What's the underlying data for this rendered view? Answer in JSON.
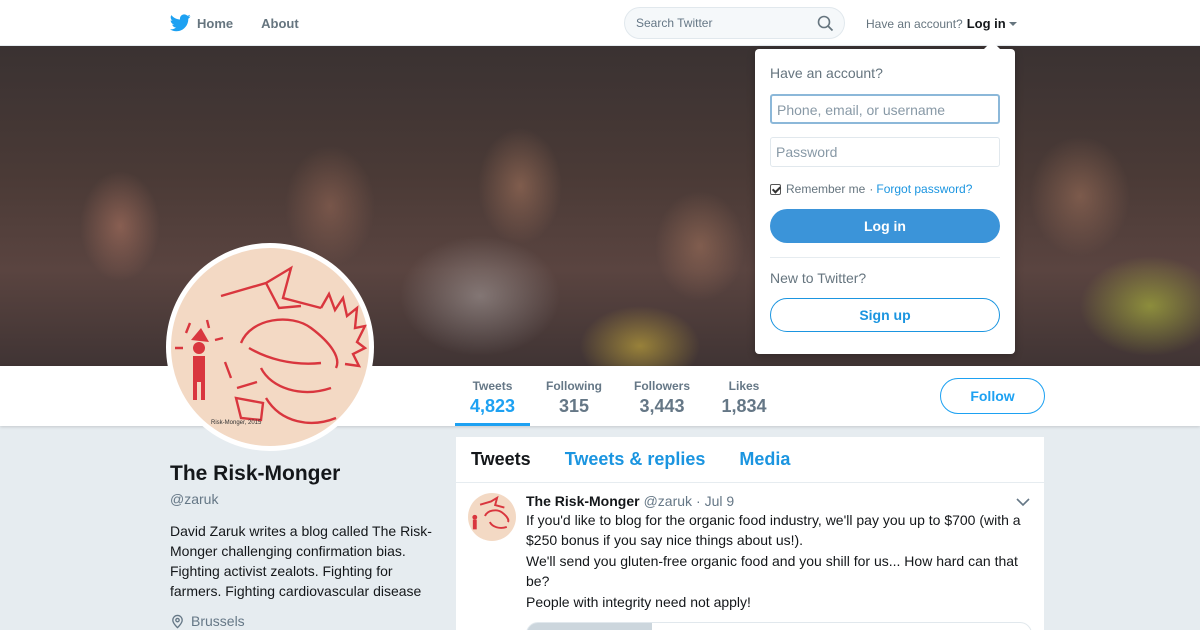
{
  "nav": {
    "home_label": "Home",
    "about_label": "About",
    "search_placeholder": "Search Twitter",
    "have_account_text": "Have an account?",
    "login_label": "Log in"
  },
  "profile": {
    "name": "The Risk-Monger",
    "handle": "@zaruk",
    "bio": "David Zaruk writes a blog called The Risk-Monger challenging confirmation bias. Fighting activist zealots. Fighting for farmers. Fighting cardiovascular disease",
    "location": "Brussels",
    "avatar_caption": "Risk-Monger, 2015"
  },
  "stats": [
    {
      "label": "Tweets",
      "value": "4,823"
    },
    {
      "label": "Following",
      "value": "315"
    },
    {
      "label": "Followers",
      "value": "3,443"
    },
    {
      "label": "Likes",
      "value": "1,834"
    }
  ],
  "follow_label": "Follow",
  "timeline": {
    "tabs": [
      "Tweets",
      "Tweets & replies",
      "Media"
    ],
    "tweet": {
      "name": "The Risk-Monger",
      "handle": "@zaruk",
      "date": "· Jul 9",
      "line1": "If you'd like to blog for the organic food industry, we'll pay you up to $700 (with a $250 bonus if you say nice things about us!).",
      "line2": "We'll send you gluten-free organic food and you shill for us... How hard can that be?",
      "line3": "People with integrity need not apply!"
    }
  },
  "login_dropdown": {
    "heading": "Have an account?",
    "username_placeholder": "Phone, email, or username",
    "password_placeholder": "Password",
    "remember_label": "Remember me",
    "separator": "·",
    "forgot_label": "Forgot password?",
    "login_button": "Log in",
    "new_to_twitter": "New to Twitter?",
    "signup_button": "Sign up"
  },
  "colors": {
    "accent": "#1da1f2",
    "login_button": "#3b94d9",
    "avatar_ink": "#d9363e"
  }
}
